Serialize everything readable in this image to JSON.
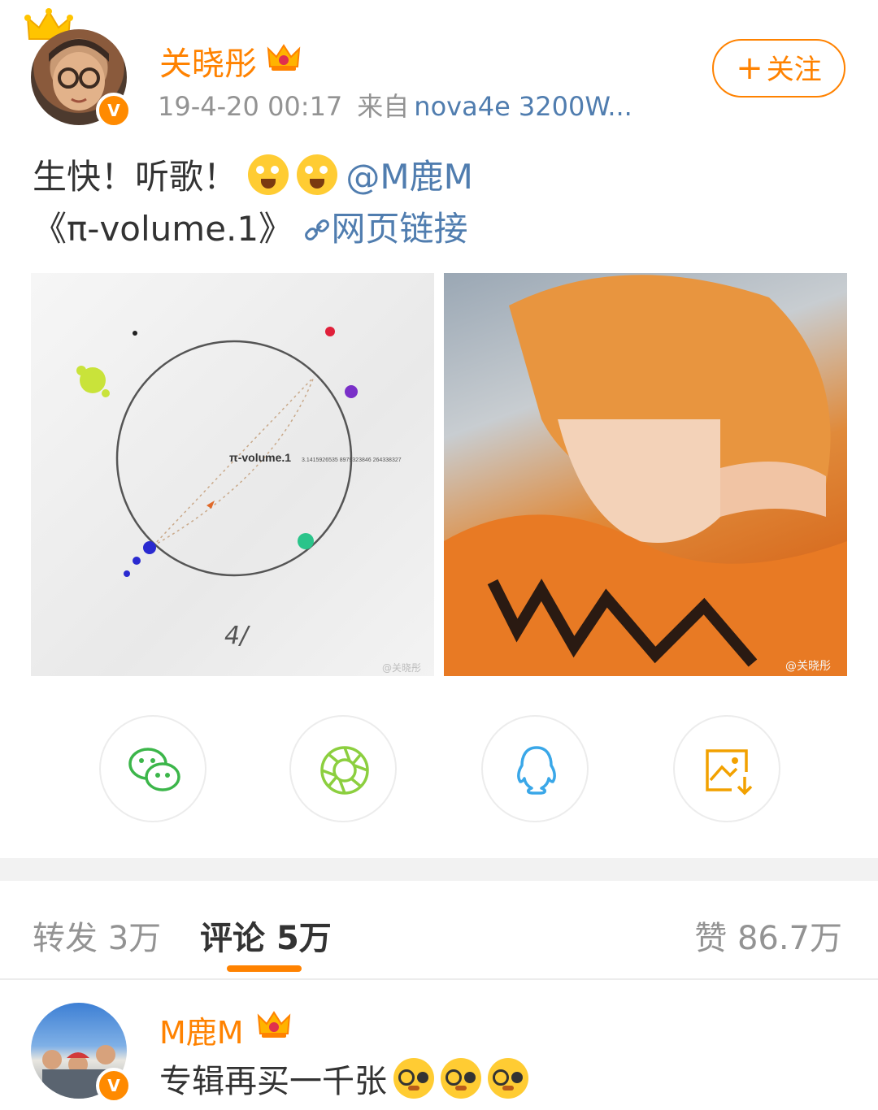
{
  "post": {
    "author": {
      "name": "关晓彤",
      "verified_mark": "V"
    },
    "timestamp": "19-4-20 00:17",
    "source_prefix": "来自",
    "source_device": "nova4e 3200W...",
    "follow_label": "关注",
    "follow_plus": "+",
    "text_line1_prefix": "生快！听歌！",
    "mention": "@M鹿M",
    "text_line2_prefix": "《π-volume.1》",
    "link_label": "网页链接",
    "images": [
      {
        "desc": "album cover",
        "caption": "π-volume.1",
        "digits": "3.1415926535 8979323846 264338327",
        "watermark": "@关晓彤"
      },
      {
        "desc": "photo",
        "watermark": "@关晓彤"
      }
    ]
  },
  "share": {
    "items": [
      {
        "icon": "wechat-icon"
      },
      {
        "icon": "moments-icon"
      },
      {
        "icon": "qq-icon"
      },
      {
        "icon": "save-image-icon"
      }
    ]
  },
  "tabs": {
    "repost_label": "转发",
    "repost_count": "3万",
    "comment_label": "评论",
    "comment_count": "5万",
    "like_label": "赞",
    "like_count": "86.7万"
  },
  "comment": {
    "author": "M鹿M",
    "verified_mark": "V",
    "text": "专辑再买一千张"
  },
  "colors": {
    "accent": "#ff8200",
    "link": "#507daf",
    "muted": "#939393"
  }
}
